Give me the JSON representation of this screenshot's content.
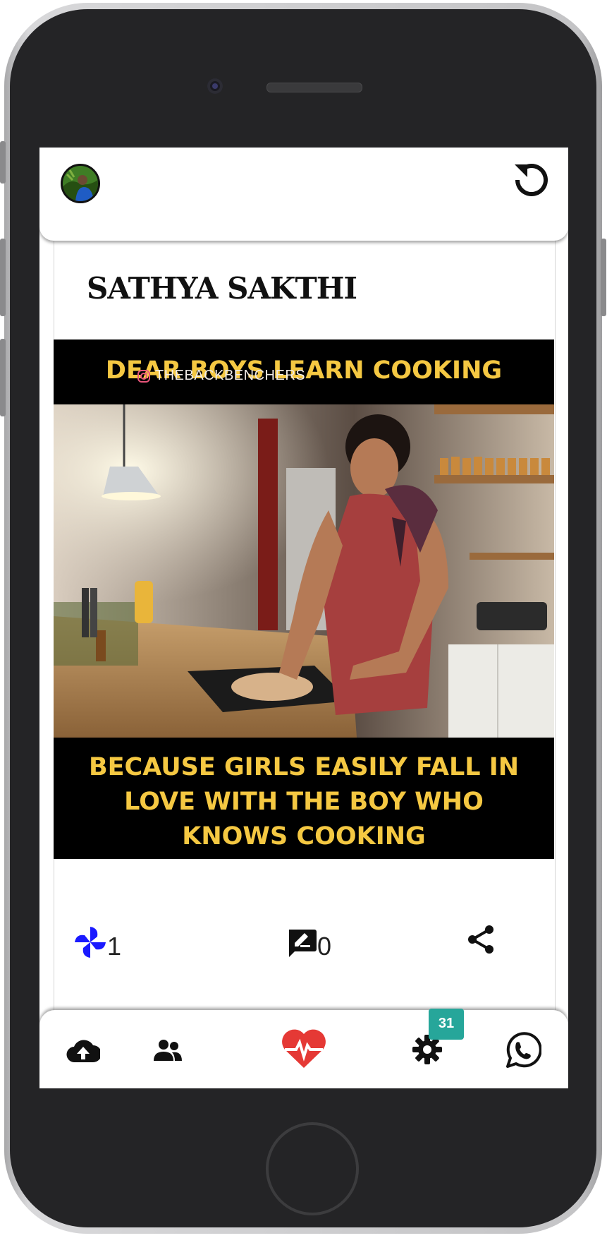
{
  "header": {
    "avatar_alt": "profile avatar",
    "refresh_icon": "refresh-icon"
  },
  "post": {
    "author": "SATHYA SAKTHI",
    "image": {
      "caption_top": "DEAR BOYS LEARN COOKING",
      "watermark": "THEBACKBENCHERS",
      "caption_bottom": [
        "BECAUSE GIRLS EASILY FALL IN",
        "LOVE WITH THE BOY WHO",
        "KNOWS COOKING"
      ]
    },
    "actions": {
      "likes": "1",
      "comments": "0",
      "like_icon": "pinwheel-icon",
      "comment_icon": "comment-edit-icon",
      "share_icon": "share-icon"
    }
  },
  "bottom_nav": {
    "items": [
      {
        "icon": "cloud-upload-icon"
      },
      {
        "icon": "users-icon"
      },
      {
        "icon": "heartbeat-icon"
      },
      {
        "icon": "settings-icon"
      },
      {
        "icon": "whatsapp-icon"
      }
    ],
    "settings_badge": "31"
  },
  "colors": {
    "caption_yellow": "#f5c842",
    "like_blue": "#1a1aff",
    "heart_red": "#e53935",
    "badge_teal": "#26a69a"
  }
}
